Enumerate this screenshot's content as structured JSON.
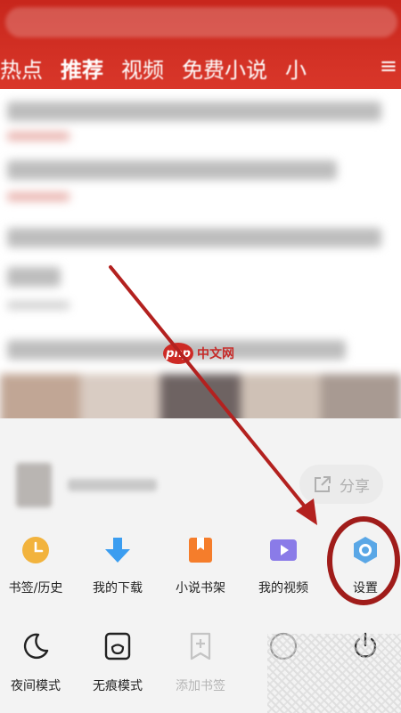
{
  "header": {
    "tabs": [
      "热点",
      "推荐",
      "视频",
      "免费小说",
      "小"
    ],
    "active_tab": "推荐",
    "menu_icon": "menu-icon"
  },
  "sheet": {
    "share_label": "分享",
    "row1": [
      {
        "label": "书签/历史",
        "icon": "clock-icon",
        "color": "#f2b33d"
      },
      {
        "label": "我的下载",
        "icon": "download-arrow-icon",
        "color": "#3b9df0"
      },
      {
        "label": "小说书架",
        "icon": "bookmark-book-icon",
        "color": "#f57d2b"
      },
      {
        "label": "我的视频",
        "icon": "video-play-icon",
        "color": "#8a7be8"
      },
      {
        "label": "设置",
        "icon": "settings-gear-icon",
        "color": "#5aa7e6"
      }
    ],
    "row2": [
      {
        "label": "夜间模式",
        "icon": "moon-icon"
      },
      {
        "label": "无痕模式",
        "icon": "incognito-card-icon"
      },
      {
        "label": "添加书签",
        "icon": "add-bookmark-icon",
        "disabled": true
      },
      {
        "label": "",
        "icon": "circle-icon"
      },
      {
        "label": "",
        "icon": "power-icon"
      }
    ]
  },
  "watermark": {
    "logo": "php",
    "text": "中文网"
  },
  "annotation": {
    "color": "#b3211f"
  }
}
